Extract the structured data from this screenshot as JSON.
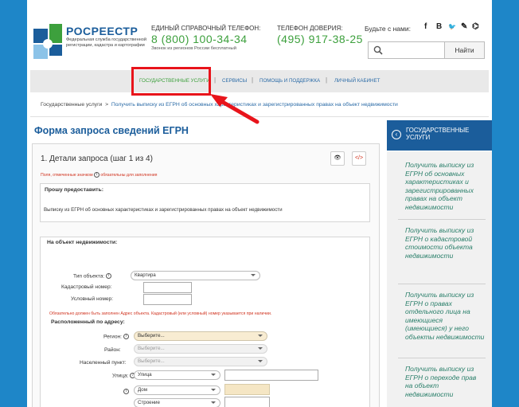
{
  "header": {
    "brand": "РОСРЕЕСТР",
    "brand_sub": "Федеральная служба государственной регистрации, кадастра и картографии",
    "hotline_label": "ЕДИНЫЙ СПРАВОЧНЫЙ ТЕЛЕФОН:",
    "hotline_number": "8 (800) 100-34-34",
    "hotline_note": "Звонок из регионов России бесплатный",
    "trust_label": "ТЕЛЕФОН ДОВЕРИЯ:",
    "trust_number": "(495) 917-38-25",
    "social_label": "Будьте с нами:",
    "social_icons": [
      "f",
      "B",
      "🐦",
      "✎",
      "⌬"
    ],
    "search_placeholder": "",
    "search_button": "Найти"
  },
  "nav": {
    "items": [
      "ГОСУДАРСТВЕННЫЕ УСЛУГИ",
      "СЕРВИСЫ",
      "ПОМОЩЬ И ПОДДЕРЖКА",
      "ЛИЧНЫЙ КАБИНЕТ"
    ],
    "separator": "|"
  },
  "breadcrumb": {
    "root": "Государственные услуги",
    "sep": ">",
    "current": "Получить выписку из ЕГРН об основных характеристиках и зарегистрированных правах на объект недвижимости"
  },
  "form": {
    "title": "Форма запроса сведений ЕГРН",
    "step": "1. Детали запроса (шаг 1 из 4)",
    "required_note_pre": "Поля, отмеченные значком",
    "required_note_post": "обязательны для заполнения",
    "provide_label": "Прошу предоставить:",
    "provide_value": "Выписку из ЕГРН об основных характеристиках и зарегистрированных правах на объект недвижимости",
    "object_label": "На объект недвижимости:",
    "object_type_label": "Тип объекта:",
    "object_type_value": "Квартира",
    "cadastral_label": "Кадастровый номер:",
    "conditional_label": "Условный номер:",
    "warning": "Обязательно должен быть заполнен Адрес объекта. Кадастровый (или условный) номер указывается при наличии.",
    "address_label": "Расположенный по адресу:",
    "region_label": "Регион:",
    "region_value": "Выберите...",
    "district_label": "Район:",
    "district_value": "Выберите...",
    "settlement_label": "Населенный пункт:",
    "settlement_value": "Выберите...",
    "street_label": "Улица:",
    "street_value": "Улица",
    "house_value": "Дом",
    "building_value": "Строение"
  },
  "sidebar": {
    "title": "ГОСУДАРСТВЕННЫЕ УСЛУГИ",
    "links": [
      "Получить выписку из ЕГРН об основных характеристиках и зарегистрированных правах на объект недвижимости",
      "Получить выписку из ЕГРН о кадастровой стоимости объекта недвижимости",
      "Получить выписку из ЕГРН о правах отдельного лица на имеющиеся (имеющиеся) у него объекты недвижимости",
      "Получить выписку из ЕГРН о переходе прав на объект недвижимости"
    ]
  },
  "colors": {
    "page_bg": "#1e86c8",
    "brand_blue": "#1b5d9b",
    "phone_green": "#3da03d",
    "highlight_red": "#e8141b",
    "sidebar_link": "#2a7f6a"
  }
}
